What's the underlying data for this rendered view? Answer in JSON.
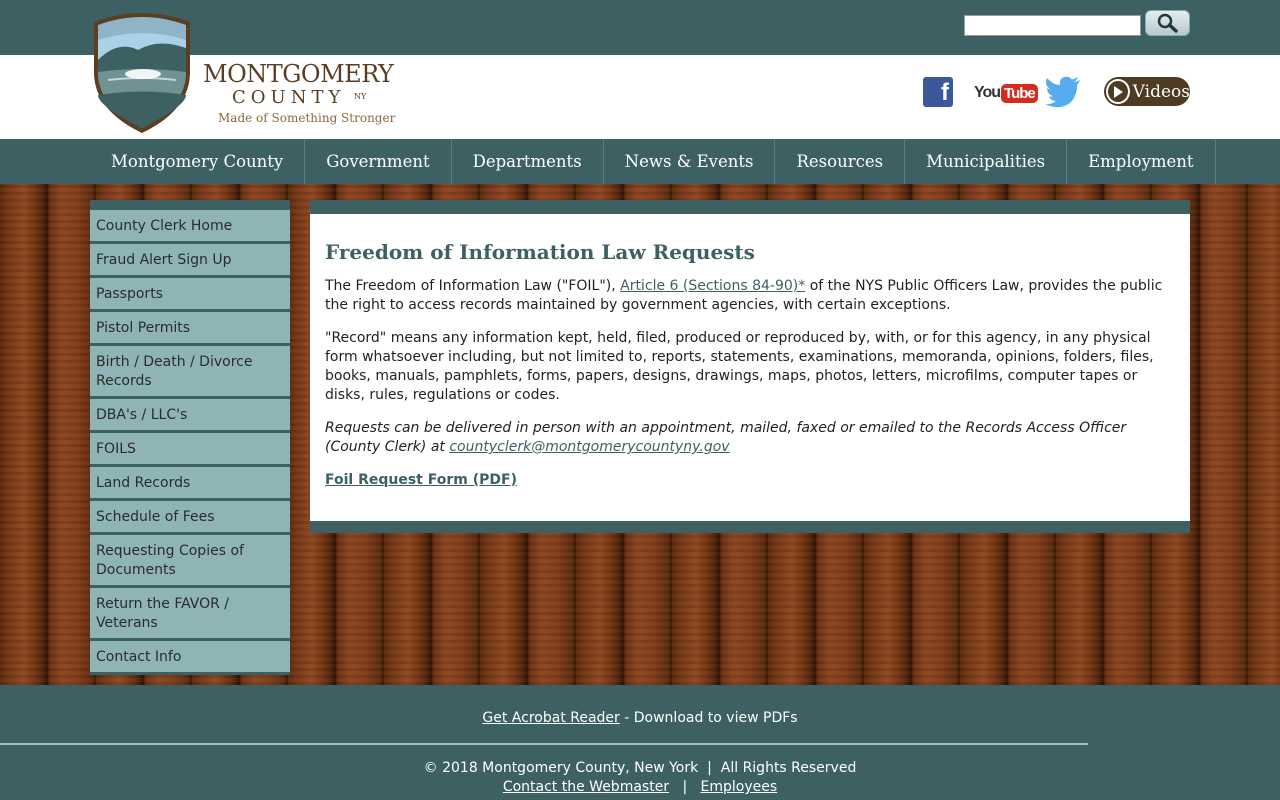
{
  "search": {
    "placeholder": "",
    "value": ""
  },
  "brand": {
    "name_line1": "MONTGOMERY",
    "name_line2": "COUNTY",
    "state": "NY",
    "tagline": "Made of Something Stronger",
    "colors": {
      "teal": "#3d6163",
      "brown": "#5a3f22",
      "sidebar": "#8fb4b6"
    }
  },
  "social": {
    "facebook": "f",
    "youtube_you": "You",
    "youtube_tube": "Tube",
    "videos": "Videos"
  },
  "nav": {
    "items": [
      "Montgomery County",
      "Government",
      "Departments",
      "News & Events",
      "Resources",
      "Municipalities",
      "Employment"
    ]
  },
  "sidebar": {
    "items": [
      "County Clerk Home",
      "Fraud Alert Sign Up",
      "Passports",
      "Pistol Permits",
      "Birth / Death / Divorce Records",
      "DBA's / LLC's",
      "FOILS",
      "Land Records",
      "Schedule of Fees",
      "Requesting Copies of Documents",
      "Return the FAVOR / Veterans",
      "Contact Info"
    ]
  },
  "main": {
    "title": "Freedom of Information Law Requests",
    "p1_before": "The Freedom of Information Law (\"FOIL\"), ",
    "p1_link": "Article 6 (Sections 84-90)*",
    "p1_after": " of the NYS Public Officers Law, provides the public the right to access records maintained by government agencies, with certain exceptions.",
    "p2": "\"Record\" means any information kept, held, filed, produced or reproduced by, with, or for this agency, in any physical form whatsoever including, but not limited to, reports, statements, examinations, memoranda, opinions, folders, files, books, manuals, pamphlets, forms, papers, designs, drawings, maps, photos, letters, microfilms, computer tapes or disks, rules, regulations or codes.",
    "p3_text": "Requests can be delivered in person with an appointment, mailed, faxed or emailed to the Records Access Officer (County Clerk) at ",
    "p3_email": "countyclerk@montgomerycountyny.gov",
    "form_link": "Foil Request Form (PDF)"
  },
  "footer": {
    "acrobat_link": "Get Acrobat Reader",
    "acrobat_text": " - Download to view PDFs",
    "copyright": "© 2018 Montgomery County, New York  |  All Rights Reserved",
    "webmaster_link": "Contact the Webmaster",
    "separator": "|",
    "employees_link": "Employees"
  }
}
